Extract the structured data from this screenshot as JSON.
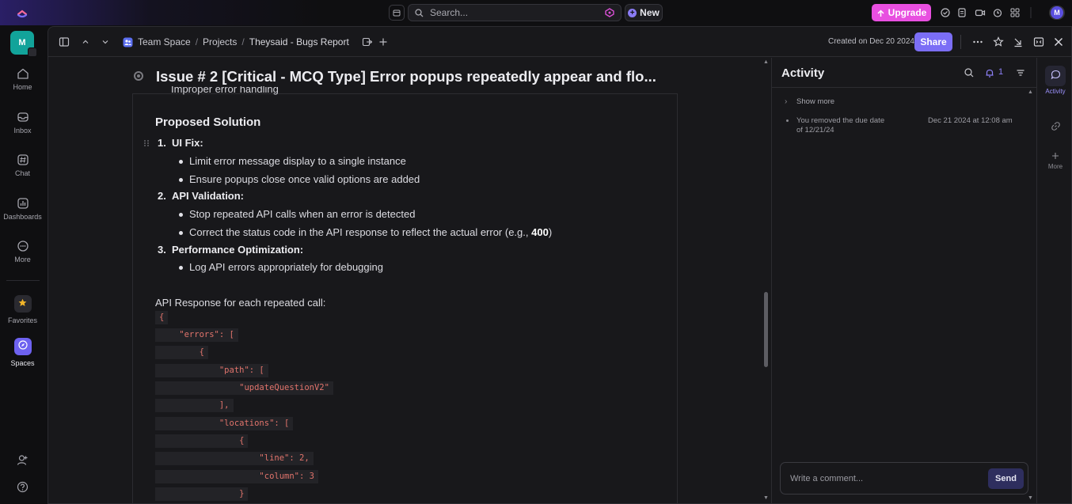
{
  "topbar": {
    "search_placeholder": "Search...",
    "new_label": "New",
    "upgrade_label": "Upgrade",
    "avatar_initial": "M"
  },
  "rail": {
    "workspace_initial": "M",
    "items": [
      {
        "label": "Home",
        "icon": "home-icon"
      },
      {
        "label": "Inbox",
        "icon": "inbox-icon"
      },
      {
        "label": "Chat",
        "icon": "chat-icon"
      },
      {
        "label": "Dashboards",
        "icon": "dashboards-icon"
      },
      {
        "label": "More",
        "icon": "more-icon"
      }
    ],
    "favorites_label": "Favorites",
    "spaces_label": "Spaces"
  },
  "header": {
    "breadcrumbs": [
      "Team Space",
      "Projects",
      "Theysaid - Bugs Report"
    ],
    "created": "Created on Dec 20 2024",
    "share_label": "Share"
  },
  "doc": {
    "title": "Issue # 2 [Critical - MCQ Type] Error popups repeatedly appear and flo...",
    "clipped_line": "Improper error handling",
    "section_heading": "Proposed Solution",
    "solutions": [
      {
        "num": "1.",
        "label": "UI Fix:",
        "bullets": [
          "Limit error message display to a single instance",
          "Ensure popups close once valid options are added"
        ]
      },
      {
        "num": "2.",
        "label": "API Validation:",
        "bullets": [
          "Stop repeated API calls when an error is detected",
          "Correct the status code in the API response to reflect the actual error (e.g., "
        ]
      },
      {
        "num": "3.",
        "label": "Performance Optimization:",
        "bullets": [
          "Log API errors appropriately for debugging"
        ]
      }
    ],
    "status_code": "400",
    "status_suffix": ")",
    "api_intro": "API Response for each repeated call:",
    "code_lines": [
      "{",
      "    \"errors\": [",
      "        {",
      "            \"path\": [",
      "                \"updateQuestionV2\"",
      "            ],",
      "            \"locations\": [",
      "                {",
      "                    \"line\": 2,",
      "                    \"column\": 3",
      "                }"
    ]
  },
  "activity": {
    "title": "Activity",
    "notification_count": "1",
    "show_more": "Show more",
    "entry_text": "You removed the due date of 12/21/24",
    "entry_date": "Dec 21 2024 at 12:08 am",
    "comment_placeholder": "Write a comment...",
    "send_label": "Send"
  },
  "right_sidebar": {
    "activity_label": "Activity",
    "more_label": "More"
  },
  "colors": {
    "accent": "#7b6ef6",
    "upgrade": "#e84fe0",
    "workspace": "#12a39a",
    "code_text": "#e2746c"
  }
}
